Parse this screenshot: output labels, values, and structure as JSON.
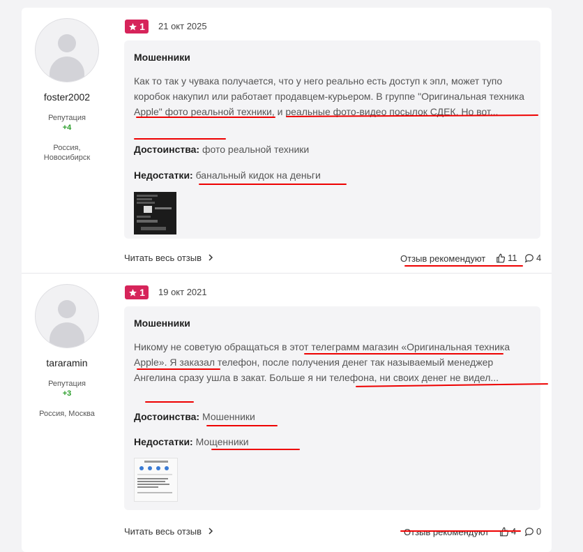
{
  "reviews": [
    {
      "rating": "1",
      "date": "21 окт 2025",
      "user": {
        "name": "foster2002",
        "rep_label": "Репутация",
        "rep_value": "+4",
        "location_line1": "Россия,",
        "location_line2": "Новосибирск"
      },
      "title": "Мошенники",
      "text": "Как то так у чувака получается, что у него реально есть доступ к эпл, может тупо коробок накупил или работает продавцем-курьером. В группе \"Оригинальная техника Apple\" фото реальной техники, и реальные фото-видео посылок СДЕК. Но вот...",
      "pros_label": "Достоинства:",
      "pros": "фото реальной техники",
      "cons_label": "Недостатки:",
      "cons": "банальный кидок на деньги",
      "read_more": "Читать весь отзыв",
      "recommend": "Отзыв рекомендуют",
      "likes": "11",
      "comments": "4"
    },
    {
      "rating": "1",
      "date": "19 окт 2021",
      "user": {
        "name": "tararamin",
        "rep_label": "Репутация",
        "rep_value": "+3",
        "location_line1": "Россия, Москва",
        "location_line2": ""
      },
      "title": "Мошенники",
      "text": "Никому не советую обращаться в этот телеграмм магазин «Оригинальная техника Apple». Я заказал телефон, после получения денег так называемый менеджер Ангелина сразу ушла в закат. Больше я ни телефона, ни своих денег не видел...",
      "pros_label": "Достоинства:",
      "pros": "Мошенники",
      "cons_label": "Недостатки:",
      "cons": "Мощенники",
      "read_more": "Читать весь отзыв",
      "recommend": "Отзыв рекомендуют",
      "likes": "4",
      "comments": "0"
    }
  ],
  "colors": {
    "rating_bg": "#d6245a",
    "rep_positive": "#2a9d2a",
    "annotation_red": "#e00000"
  },
  "icons": [
    "star-icon",
    "chevron-right-icon",
    "thumbs-up-icon",
    "comment-icon",
    "avatar-icon"
  ]
}
